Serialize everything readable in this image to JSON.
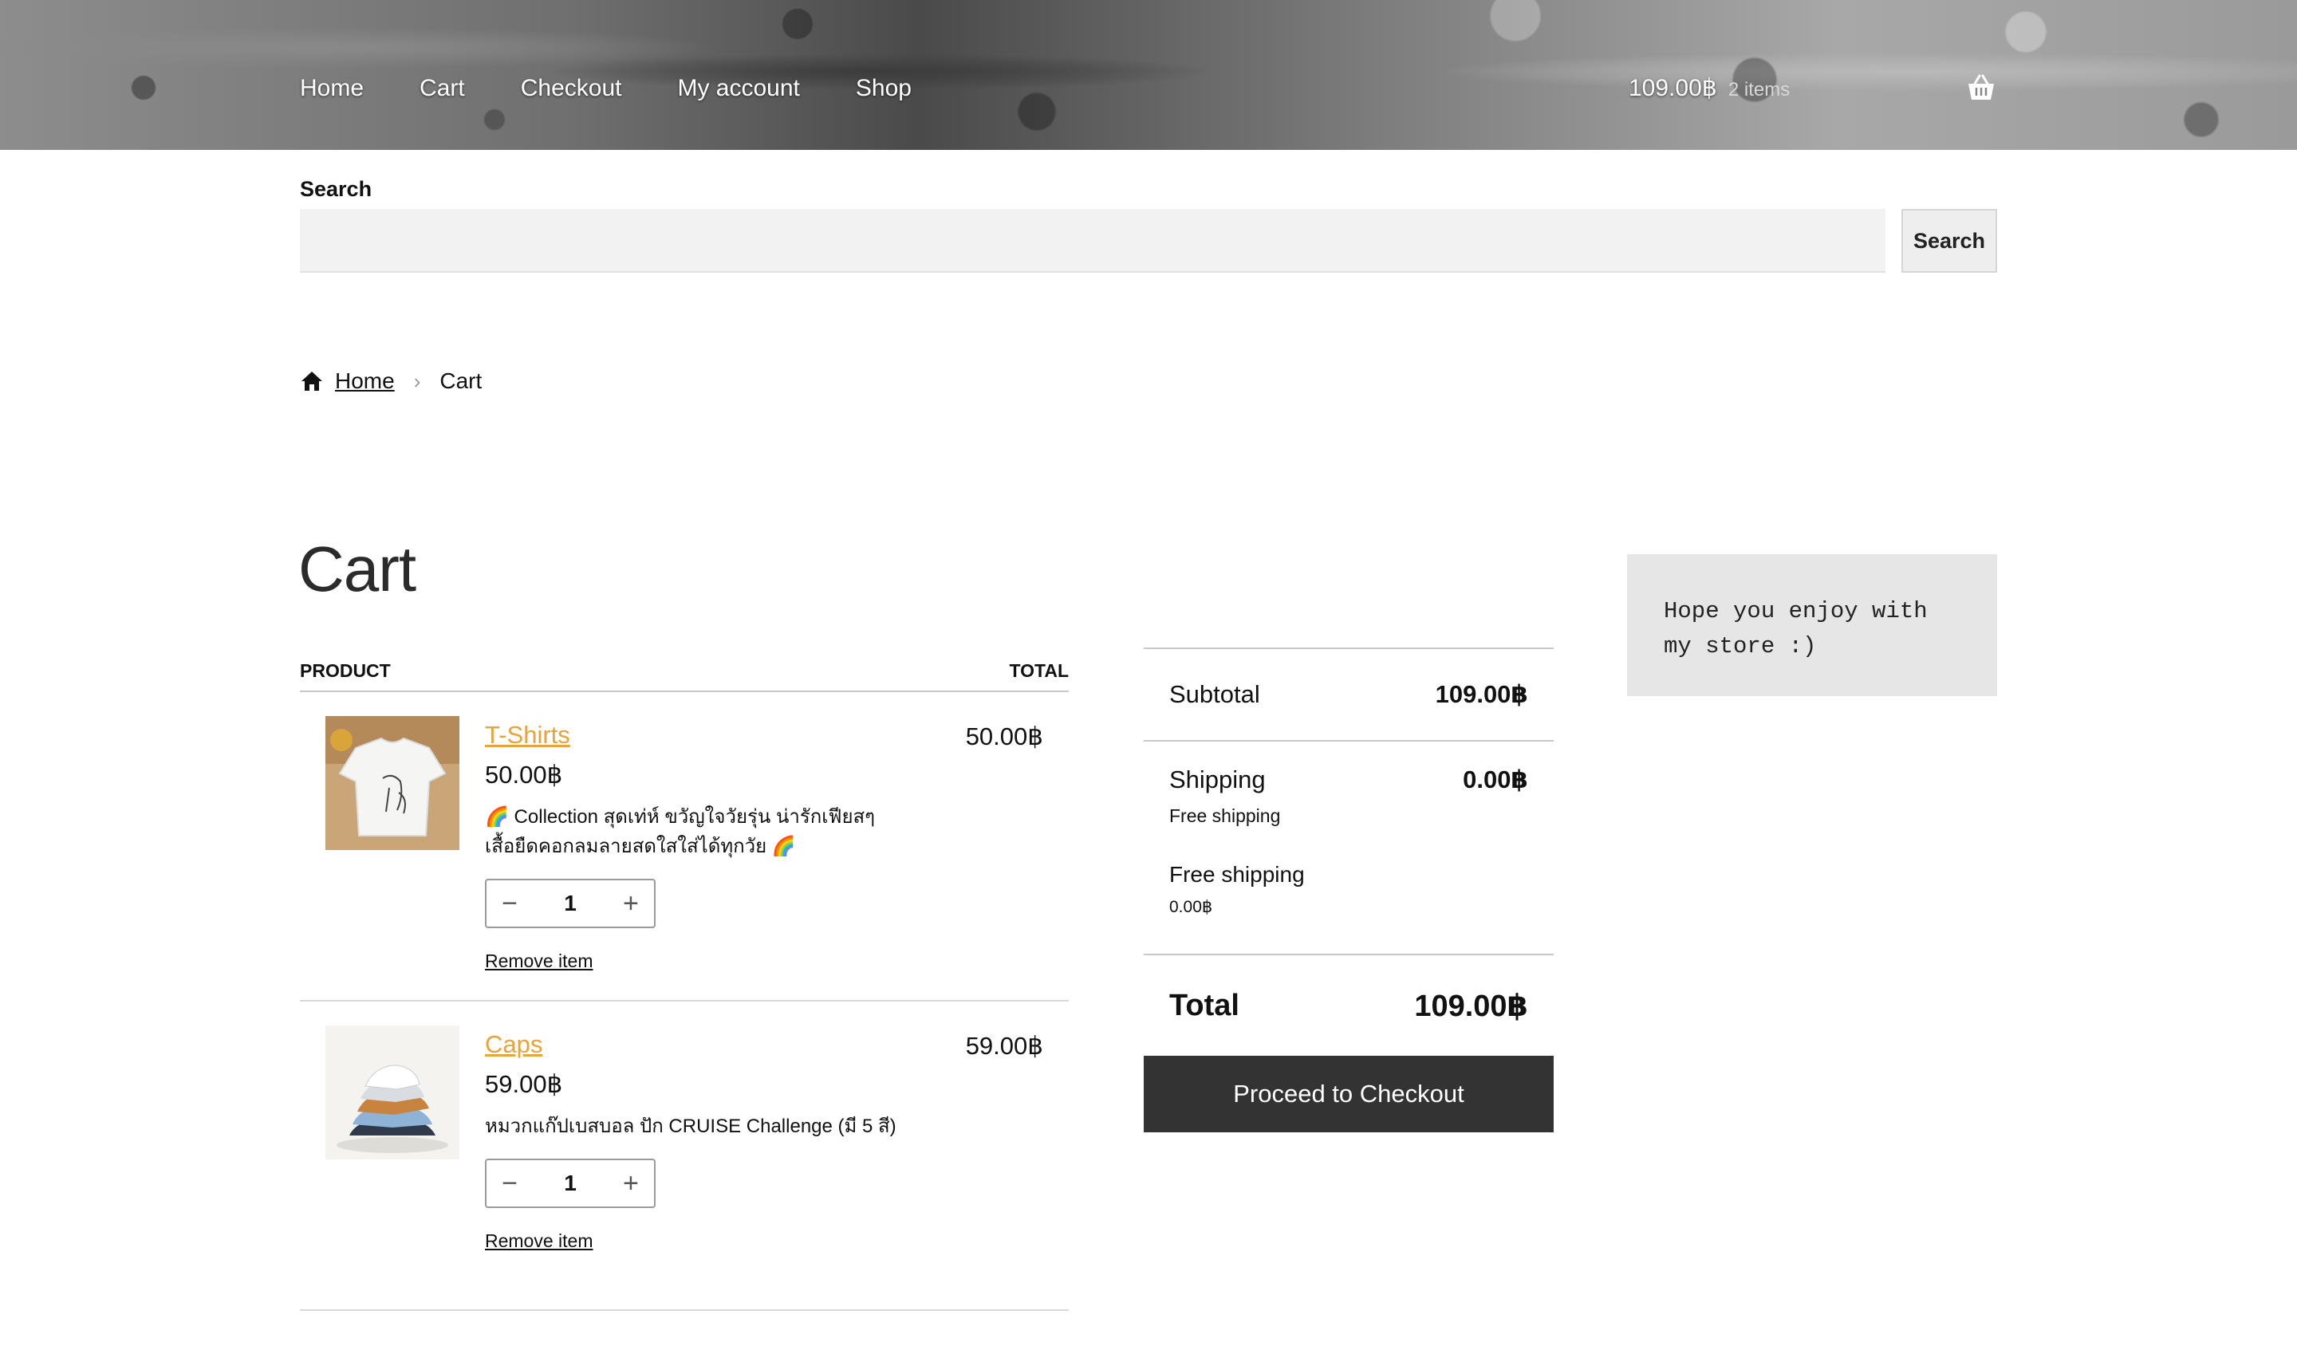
{
  "header": {
    "nav": [
      "Home",
      "Cart",
      "Checkout",
      "My account",
      "Shop"
    ],
    "cart_amount": "109.00฿",
    "cart_count": "2 items"
  },
  "search": {
    "label": "Search",
    "placeholder": "",
    "value": "",
    "button": "Search"
  },
  "breadcrumb": {
    "home": "Home",
    "separator": "›",
    "current": "Cart"
  },
  "page_title": "Cart",
  "cart_table": {
    "headers": {
      "product": "PRODUCT",
      "total": "TOTAL"
    },
    "items": [
      {
        "name": "T-Shirts",
        "price": "50.00฿",
        "description": "🌈 Collection สุดเท่ห์ ขวัญใจวัยรุ่น น่ารักเฟียสๆ เสื้อยืดคอกลมลายสดใสใส่ได้ทุกวัย 🌈",
        "quantity": "1",
        "remove": "Remove item",
        "total": "50.00฿"
      },
      {
        "name": "Caps",
        "price": "59.00฿",
        "description": "หมวกแก๊ปเบสบอล ปัก CRUISE Challenge (มี 5 สี)",
        "quantity": "1",
        "remove": "Remove item",
        "total": "59.00฿"
      }
    ],
    "minus": "−",
    "plus": "+"
  },
  "totals": {
    "subtotal_label": "Subtotal",
    "subtotal_value": "109.00฿",
    "shipping_label": "Shipping",
    "shipping_value": "0.00฿",
    "shipping_note": "Free shipping",
    "shipping_method": "Free shipping",
    "shipping_method_price": "0.00฿",
    "total_label": "Total",
    "total_value": "109.00฿",
    "checkout": "Proceed to Checkout"
  },
  "sidebar": {
    "note": "Hope you enjoy with my store :)"
  },
  "colors": {
    "link_accent": "#e8a33a",
    "checkout_bg": "#333333",
    "sidebar_bg": "#e6e6e6"
  }
}
